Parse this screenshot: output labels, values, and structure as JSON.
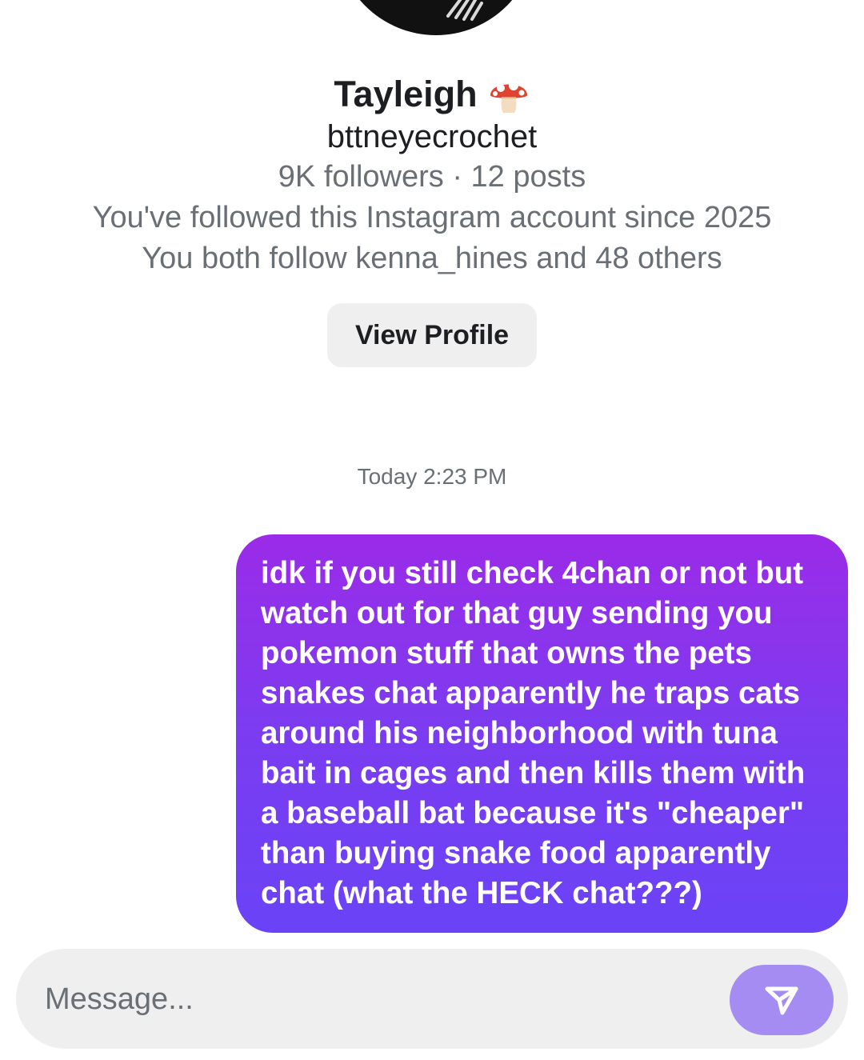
{
  "profile": {
    "name": "Tayleigh",
    "name_emoji_icon": "mushroom-icon",
    "username": "bttneyecrochet",
    "stats": "9K followers · 12 posts",
    "follow_since": "You've followed this Instagram account since 2025",
    "mutuals": "You both follow kenna_hines and 48 others",
    "view_profile_label": "View Profile"
  },
  "thread": {
    "timestamp": "Today 2:23 PM",
    "messages": [
      {
        "from": "me",
        "lines": [
          "idk if you still check 4chan or not but",
          "watch out for that guy sending you",
          "pokemon stuff that owns the pets",
          "snakes chat apparently he traps cats",
          "around his neighborhood with tuna",
          "bait in cages and then kills them with",
          "a baseball bat because it's \"cheaper\"",
          "than buying snake food apparently",
          "chat (what the HECK chat???)"
        ]
      }
    ]
  },
  "composer": {
    "placeholder": "Message...",
    "send_icon": "send-icon"
  },
  "colors": {
    "bubble_top": "#9b2be8",
    "bubble_bottom": "#6a43f7",
    "send_button": "#a48cf2",
    "secondary_text": "#6a6f75"
  }
}
